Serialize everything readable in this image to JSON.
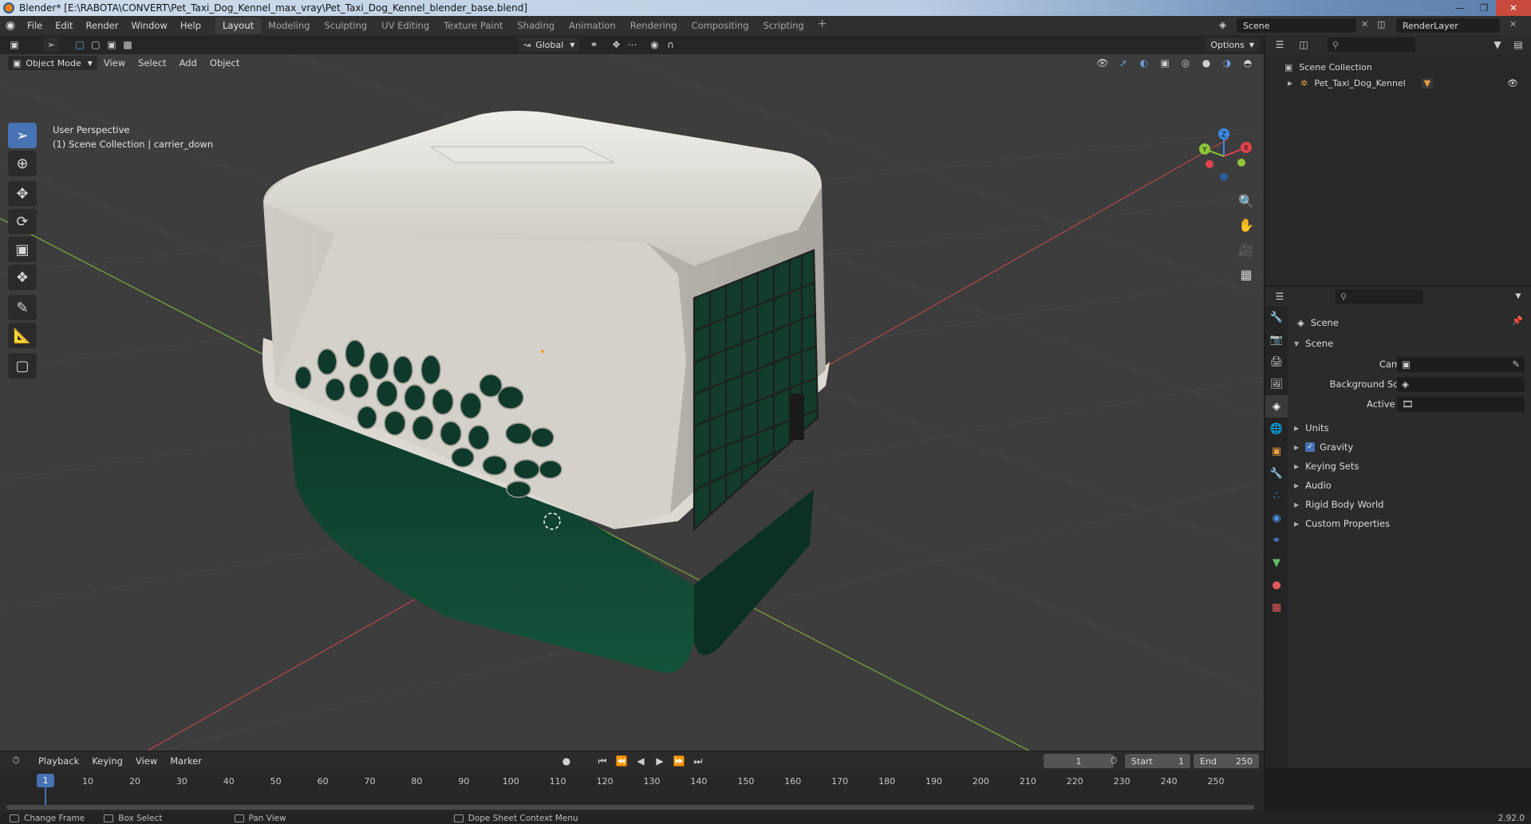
{
  "window": {
    "title": "Blender* [E:\\RABOTA\\CONVERT\\Pet_Taxi_Dog_Kennel_max_vray\\Pet_Taxi_Dog_Kennel_blender_base.blend]",
    "minimize": "—",
    "maximize": "❐",
    "close": "✕"
  },
  "menu": [
    "File",
    "Edit",
    "Render",
    "Window",
    "Help"
  ],
  "workspaces": [
    "Layout",
    "Modeling",
    "Sculpting",
    "UV Editing",
    "Texture Paint",
    "Shading",
    "Animation",
    "Rendering",
    "Compositing",
    "Scripting"
  ],
  "workspace_add": "+",
  "scene_name": "Scene",
  "render_layer": "RenderLayer",
  "viewport": {
    "transform_orientation": "Global",
    "options_label": "Options",
    "mode": "Object Mode",
    "header_menus": [
      "View",
      "Select",
      "Add",
      "Object"
    ],
    "info_line1": "User Perspective",
    "info_line2": "(1) Scene Collection | carrier_down",
    "gizmo": {
      "x": "X",
      "y": "Y",
      "z": "Z"
    }
  },
  "outliner": {
    "root": "Scene Collection",
    "items": [
      "Pet_Taxi_Dog_Kennel"
    ]
  },
  "properties": {
    "context": "Scene",
    "section": "Scene",
    "fields": [
      {
        "label": "Camera",
        "value": ""
      },
      {
        "label": "Background Scene",
        "value": ""
      },
      {
        "label": "Active Clip",
        "value": ""
      }
    ],
    "panels": [
      {
        "label": "Units",
        "checkbox": false
      },
      {
        "label": "Gravity",
        "checkbox": true
      },
      {
        "label": "Keying Sets",
        "checkbox": false
      },
      {
        "label": "Audio",
        "checkbox": false
      },
      {
        "label": "Rigid Body World",
        "checkbox": false
      },
      {
        "label": "Custom Properties",
        "checkbox": false
      }
    ]
  },
  "timeline": {
    "menus": [
      "Playback",
      "Keying",
      "View",
      "Marker"
    ],
    "current_frame": "1",
    "start_label": "Start",
    "start": "1",
    "end_label": "End",
    "end": "250",
    "ticks": [
      "1",
      "10",
      "20",
      "30",
      "40",
      "50",
      "60",
      "70",
      "80",
      "90",
      "100",
      "110",
      "120",
      "130",
      "140",
      "150",
      "160",
      "170",
      "180",
      "190",
      "200",
      "210",
      "220",
      "230",
      "240",
      "250"
    ]
  },
  "statusbar": {
    "items": [
      "Change Frame",
      "Box Select",
      "Pan View",
      "Dope Sheet Context Menu"
    ],
    "version": "2.92.0"
  },
  "colors": {
    "accent": "#4772b3",
    "kennel_top": "#d8d5cf",
    "kennel_base": "#0f3a2b",
    "axis_x": "#e2434a",
    "axis_y": "#8cc43a",
    "axis_z": "#3d8ae2"
  }
}
